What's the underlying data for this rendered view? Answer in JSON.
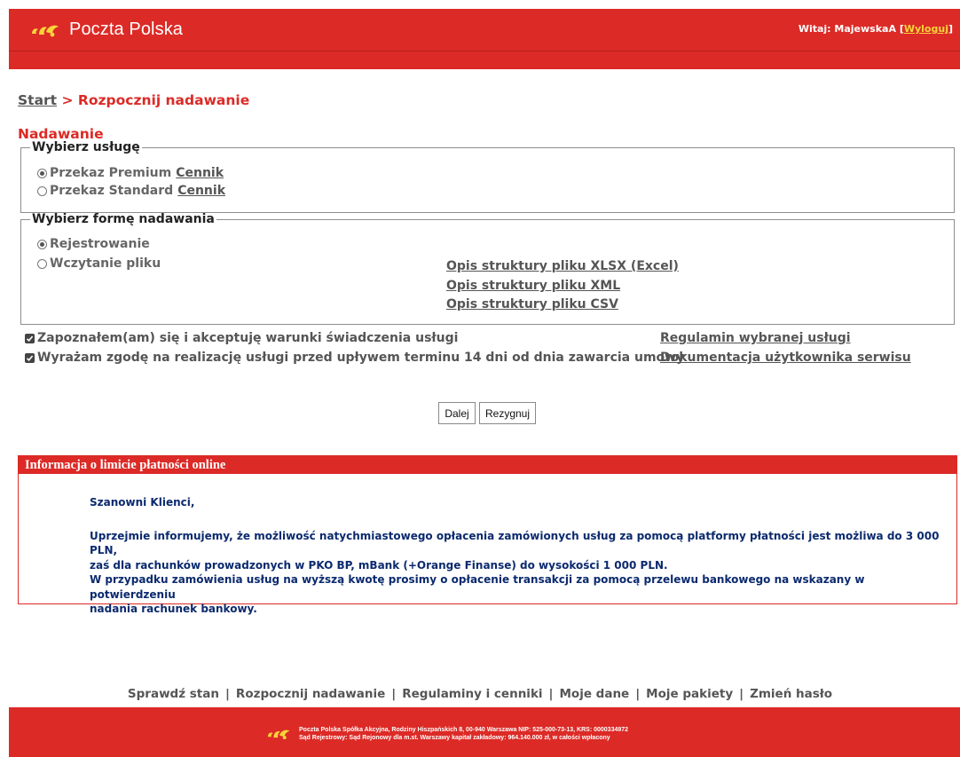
{
  "header": {
    "brand": "Poczta Polska",
    "greeting": "Witaj: MajewskaA",
    "logout_open": "[",
    "logout_label": "Wyloguj",
    "logout_close": "]",
    "logo_icon": "poczta-polska-horn-logo"
  },
  "breadcrumb": {
    "start": "Start",
    "separator": ">",
    "current": "Rozpocznij nadawanie"
  },
  "section_title": "Nadawanie",
  "service": {
    "legend": "Wybierz usługę",
    "options": [
      {
        "label": "Przekaz Premium",
        "link": "Cennik",
        "selected": true
      },
      {
        "label": "Przekaz Standard",
        "link": "Cennik",
        "selected": false
      }
    ]
  },
  "mode": {
    "legend": "Wybierz formę nadawania",
    "options": [
      {
        "label": "Rejestrowanie",
        "selected": true
      },
      {
        "label": "Wczytanie pliku",
        "selected": false
      }
    ],
    "doc_links": [
      "Opis struktury pliku XLSX (Excel)",
      "Opis struktury pliku XML",
      "Opis struktury pliku CSV"
    ]
  },
  "consents": [
    {
      "label": "Zapoznałem(am) się i akceptuję warunki świadczenia usługi",
      "checked": true,
      "link": "Regulamin wybranej usługi"
    },
    {
      "label": "Wyrażam zgodę na realizację usługi przed upływem terminu 14 dni od dnia zawarcia umowy",
      "checked": true,
      "link": "Dokumentacja użytkownika serwisu"
    }
  ],
  "buttons": {
    "next": "Dalej",
    "cancel": "Rezygnuj"
  },
  "info": {
    "title": "Informacja o limicie płatności online",
    "greeting": "Szanowni Klienci,",
    "line1": "Uprzejmie informujemy, że możliwość natychmiastowego opłacenia zamówionych usług za pomocą platformy płatności jest możliwa do 3 000 PLN,",
    "line2": "zaś dla rachunków prowadzonych w PKO BP, mBank (+Orange Finanse) do wysokości 1 000 PLN.",
    "line3": "W przypadku zamówienia usług na wyższą kwotę prosimy o opłacenie transakcji za pomocą przelewu bankowego na wskazany w potwierdzeniu",
    "line4": "nadania rachunek bankowy."
  },
  "footer_nav": [
    "Sprawdź stan",
    "Rozpocznij nadawanie",
    "Regulaminy i cenniki",
    "Moje dane",
    "Moje pakiety",
    "Zmień hasło"
  ],
  "footer": {
    "line1": "Poczta Polska Spółka Akcyjna, Rodziny Hiszpańskich 8, 00-940 Warszawa NIP: 525-000-73-13, KRS: 0000334972",
    "line2": "Sąd Rejestrowy: Sąd Rejonowy dla m.st. Warszawy kapitał zakładowy: 964.140.000 zł, w całości wpłacony"
  },
  "colors": {
    "brand_red": "#dc2a26",
    "logo_yellow": "#f7d43a",
    "info_text": "#0b2a6e"
  }
}
